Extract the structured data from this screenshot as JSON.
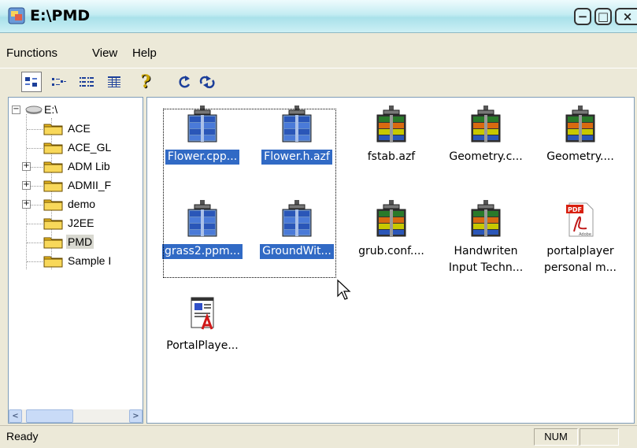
{
  "window": {
    "title": "E:\\PMD",
    "controls": {
      "minimize": "−",
      "restore": "□",
      "close": "×"
    }
  },
  "menu": [
    "Functions",
    "View",
    "Help"
  ],
  "toolbar": {
    "buttons": [
      "large-icons-view",
      "small-icons-view",
      "list-view",
      "details-view",
      "help",
      "refresh",
      "sync"
    ],
    "help_glyph": "?"
  },
  "tree": {
    "root": "E:\\",
    "items": [
      {
        "label": "ACE",
        "expandable": false,
        "expander": ""
      },
      {
        "label": "ACE_GL",
        "expandable": false,
        "expander": ""
      },
      {
        "label": "ADM Lib",
        "expandable": true,
        "expander": "+"
      },
      {
        "label": "ADMII_F",
        "expandable": true,
        "expander": "+"
      },
      {
        "label": "demo",
        "expandable": true,
        "expander": "+"
      },
      {
        "label": "J2EE",
        "expandable": false,
        "expander": ""
      },
      {
        "label": "PMD",
        "expandable": false,
        "expander": "",
        "selected": true
      },
      {
        "label": "Sample I",
        "expandable": false,
        "expander": ""
      }
    ],
    "root_expander": "−",
    "scroll": {
      "left": "<",
      "right": ">"
    }
  },
  "files": [
    {
      "line1": "Flower.cpp...",
      "line2": "",
      "type": "archive-blue",
      "selected": true
    },
    {
      "line1": "Flower.h.azf",
      "line2": "",
      "type": "archive-blue",
      "selected": true
    },
    {
      "line1": "fstab.azf",
      "line2": "",
      "type": "archive-color",
      "selected": false
    },
    {
      "line1": "Geometry.c...",
      "line2": "",
      "type": "archive-color",
      "selected": false
    },
    {
      "line1": "Geometry....",
      "line2": "",
      "type": "archive-color",
      "selected": false
    },
    {
      "line1": "grass2.ppm...",
      "line2": "",
      "type": "archive-blue",
      "selected": true
    },
    {
      "line1": "GroundWit...",
      "line2": "",
      "type": "archive-blue",
      "selected": true
    },
    {
      "line1": "grub.conf....",
      "line2": "",
      "type": "archive-color",
      "selected": false
    },
    {
      "line1": "Handwriten",
      "line2": "Input Techn...",
      "type": "archive-color",
      "selected": false
    },
    {
      "line1": "portalplayer",
      "line2": "personal m...",
      "type": "pdf",
      "selected": false
    },
    {
      "line1": "PortalPlaye...",
      "line2": "",
      "type": "document",
      "selected": false
    }
  ],
  "pdf_badge": "PDF",
  "pdf_brand": "Adobe",
  "status": {
    "text": "Ready",
    "num": "NUM"
  }
}
